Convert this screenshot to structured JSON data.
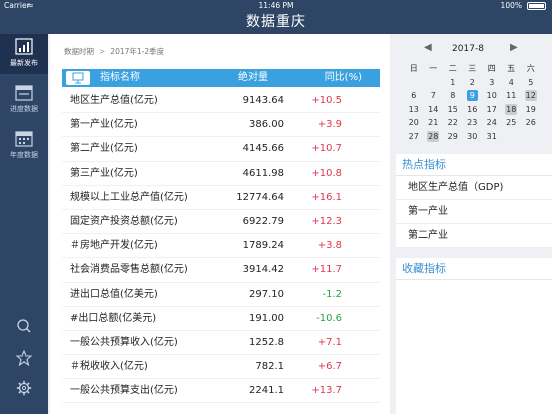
{
  "status_bar": {
    "carrier": "Carrier",
    "wifi": "≈",
    "time": "11:46 PM",
    "battery_pct": "100%"
  },
  "app": {
    "title": "数据重庆"
  },
  "sidebar": {
    "items": [
      {
        "label": "最新发布",
        "icon": "bar-chart-icon",
        "active": true
      },
      {
        "label": "进度数据",
        "icon": "calendar-progress-icon",
        "active": false
      },
      {
        "label": "年度数据",
        "icon": "calendar-year-icon",
        "active": false
      }
    ],
    "bottom": [
      "search-icon",
      "star-icon",
      "gear-icon"
    ]
  },
  "breadcrumb": {
    "label": "数据时期",
    "separator": ">",
    "period": "2017年1-2季度"
  },
  "table": {
    "columns": [
      "指标名称",
      "绝对量",
      "同比(%)"
    ],
    "rows": [
      {
        "name": "地区生产总值(亿元)",
        "value": "9143.64",
        "pct": "+10.5",
        "trend": "up"
      },
      {
        "name": "第一产业(亿元)",
        "value": "386.00",
        "pct": "+3.9",
        "trend": "up"
      },
      {
        "name": "第二产业(亿元)",
        "value": "4145.66",
        "pct": "+10.7",
        "trend": "up"
      },
      {
        "name": "第三产业(亿元)",
        "value": "4611.98",
        "pct": "+10.8",
        "trend": "up"
      },
      {
        "name": "规模以上工业总产值(亿元)",
        "value": "12774.64",
        "pct": "+16.1",
        "trend": "up"
      },
      {
        "name": "固定资产投资总额(亿元)",
        "value": "6922.79",
        "pct": "+12.3",
        "trend": "up"
      },
      {
        "name": "＃房地产开发(亿元)",
        "value": "1789.24",
        "pct": "+3.8",
        "trend": "up"
      },
      {
        "name": "社会消费品零售总额(亿元)",
        "value": "3914.42",
        "pct": "+11.7",
        "trend": "up"
      },
      {
        "name": "进出口总值(亿美元)",
        "value": "297.10",
        "pct": "-1.2",
        "trend": "down"
      },
      {
        "name": "#出口总额(亿美元)",
        "value": "191.00",
        "pct": "-10.6",
        "trend": "down"
      },
      {
        "name": "一般公共预算收入(亿元)",
        "value": "1252.8",
        "pct": "+7.1",
        "trend": "up"
      },
      {
        "name": "＃税收收入(亿元)",
        "value": "782.1",
        "pct": "+6.7",
        "trend": "up"
      },
      {
        "name": "一般公共预算支出(亿元)",
        "value": "2241.1",
        "pct": "+13.7",
        "trend": "up"
      }
    ]
  },
  "calendar": {
    "prev": "◀",
    "month": "2017-8",
    "next": "▶",
    "weekdays": [
      "日",
      "一",
      "二",
      "三",
      "四",
      "五",
      "六"
    ],
    "weeks": [
      [
        "",
        "",
        "1",
        "2",
        "3",
        "4",
        "5"
      ],
      [
        "6",
        "7",
        "8",
        "9",
        "10",
        "11",
        "12"
      ],
      [
        "13",
        "14",
        "15",
        "16",
        "17",
        "18",
        "19"
      ],
      [
        "20",
        "21",
        "22",
        "23",
        "24",
        "25",
        "26"
      ],
      [
        "27",
        "28",
        "29",
        "30",
        "31",
        "",
        ""
      ]
    ],
    "selected": "9",
    "marked": [
      "12",
      "18",
      "28"
    ]
  },
  "hot": {
    "title": "热点指标",
    "items": [
      "地区生产总值（GDP)",
      "第一产业",
      "第二产业"
    ]
  },
  "favorites": {
    "title": "收藏指标"
  },
  "colors": {
    "nav": "#2e4566",
    "accent": "#3aa0df",
    "up": "#e0374b",
    "down": "#2e9e3f"
  }
}
